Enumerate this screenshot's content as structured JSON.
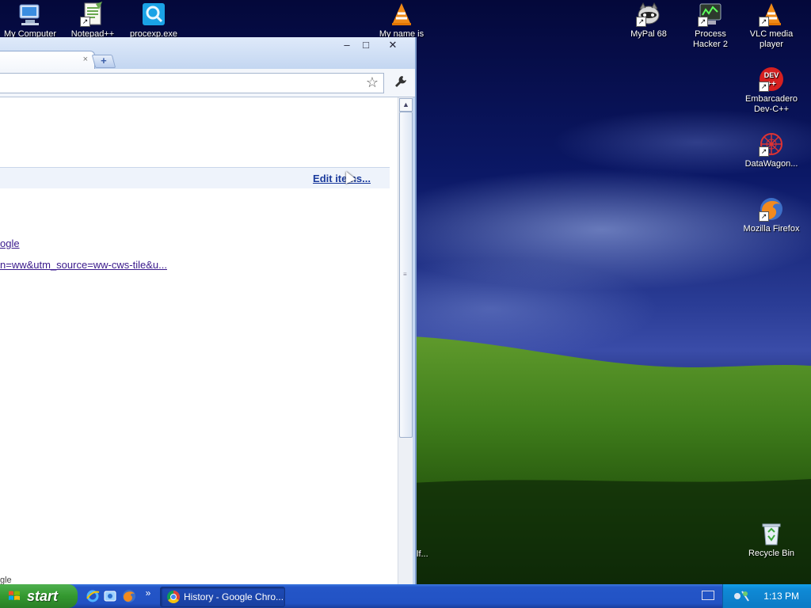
{
  "desktop": {
    "icons": [
      {
        "label": "My Computer",
        "icon": "computer-icon"
      },
      {
        "label": "Notepad++",
        "icon": "notepad-plus-plus-icon"
      },
      {
        "label": "procexp.exe",
        "icon": "procexp-icon"
      },
      {
        "label": "My name is",
        "icon": "vlc-icon"
      },
      {
        "label": "MyPal 68",
        "icon": "mypal-icon"
      },
      {
        "label": "Process Hacker 2",
        "icon": "process-hacker-icon"
      },
      {
        "label": "VLC media player",
        "icon": "vlc-icon"
      },
      {
        "label": "Embarcadero Dev-C++",
        "icon": "devcpp-icon"
      },
      {
        "label": "DataWagon...",
        "icon": "datawagon-icon"
      },
      {
        "label": "Mozilla Firefox",
        "icon": "firefox-icon"
      },
      {
        "label": "Recycle Bin",
        "icon": "recycle-bin-icon"
      }
    ],
    "partial_label": "lf..."
  },
  "browser": {
    "tab_close": "×",
    "new_tab": "+",
    "window_buttons": {
      "minimize": "–",
      "maximize": "□",
      "close": "✕"
    },
    "edit_items": "Edit items...",
    "links": [
      "ogle",
      "n=ww&utm_source=ww-cws-tile&u..."
    ],
    "cut_text": "gle"
  },
  "taskbar": {
    "start_label": "start",
    "task_title": "History - Google Chro...",
    "chevron": "»",
    "clock": "1:13 PM"
  },
  "colors": {
    "taskbar_blue": "#2456c8",
    "start_green": "#33982f",
    "link": "#1a3a9c"
  }
}
